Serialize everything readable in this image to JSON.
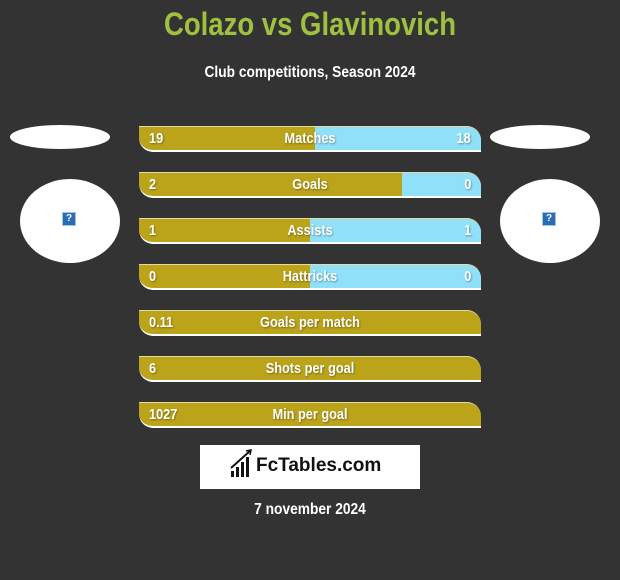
{
  "header": {
    "title": "Colazo vs Glavinovich",
    "subtitle": "Club competitions, Season 2024"
  },
  "players": {
    "left": {
      "name": "Colazo",
      "image_icon": "missing-image-icon"
    },
    "right": {
      "name": "Glavinovich",
      "image_icon": "missing-image-icon"
    }
  },
  "colors": {
    "left_bar": "#bba31a",
    "right_bar": "#8fe0f8",
    "title": "#a0c040",
    "background": "#333333"
  },
  "stats": [
    {
      "label": "Matches",
      "left": "19",
      "right": "18",
      "left_share": 0.514
    },
    {
      "label": "Goals",
      "left": "2",
      "right": "0",
      "left_share": 0.77
    },
    {
      "label": "Assists",
      "left": "1",
      "right": "1",
      "left_share": 0.5
    },
    {
      "label": "Hattricks",
      "left": "0",
      "right": "0",
      "left_share": 0.5
    },
    {
      "label": "Goals per match",
      "left": "0.11",
      "right": "",
      "left_share": 1.0
    },
    {
      "label": "Shots per goal",
      "left": "6",
      "right": "",
      "left_share": 1.0
    },
    {
      "label": "Min per goal",
      "left": "1027",
      "right": "",
      "left_share": 1.0
    }
  ],
  "footer": {
    "logo_text": "FcTables.com",
    "date": "7 november 2024"
  }
}
